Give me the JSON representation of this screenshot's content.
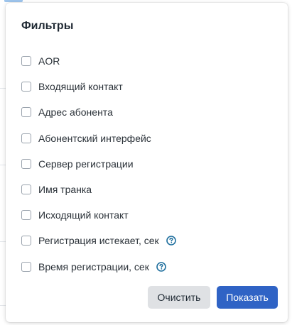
{
  "panel": {
    "title": "Фильтры",
    "filters": [
      {
        "label": "AOR",
        "checked": false,
        "help": false
      },
      {
        "label": "Входящий контакт",
        "checked": false,
        "help": false
      },
      {
        "label": "Адрес абонента",
        "checked": false,
        "help": false
      },
      {
        "label": "Абонентский интерфейс",
        "checked": false,
        "help": false
      },
      {
        "label": "Сервер регистрации",
        "checked": false,
        "help": false
      },
      {
        "label": "Имя транка",
        "checked": false,
        "help": false
      },
      {
        "label": "Исходящий контакт",
        "checked": false,
        "help": false
      },
      {
        "label": "Регистрация истекает, сек",
        "checked": false,
        "help": true
      },
      {
        "label": "Время регистрации, сек",
        "checked": false,
        "help": true
      }
    ],
    "buttons": {
      "clear_label": "Очистить",
      "show_label": "Показать"
    }
  },
  "icons": {
    "help": "question-circle-icon"
  },
  "colors": {
    "primary": "#2f63c5",
    "secondary_button": "#dfe1e4",
    "help_icon": "#1f6f9e",
    "checkbox_border": "#9aa3ad"
  }
}
